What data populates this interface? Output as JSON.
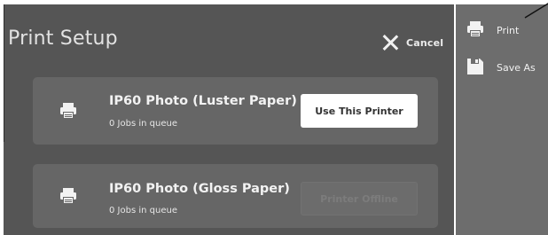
{
  "dialog": {
    "title": "Print Setup",
    "cancel_label": "Cancel"
  },
  "printers": [
    {
      "name": "IP60 Photo (Luster Paper)",
      "status": "0 Jobs in queue",
      "action_label": "Use This Printer",
      "action_enabled": true
    },
    {
      "name": "IP60 Photo (Gloss Paper)",
      "status": "0 Jobs in queue",
      "action_label": "Printer Offline",
      "action_enabled": false
    }
  ],
  "sidebar": {
    "items": [
      {
        "label": "Print",
        "icon": "printer-icon"
      },
      {
        "label": "Save As",
        "icon": "save-icon"
      }
    ]
  },
  "colors": {
    "dialog_bg": "#555555",
    "card_bg": "#666666",
    "sidebar_bg": "#6d6d6d",
    "primary_button_bg": "#ffffff"
  }
}
